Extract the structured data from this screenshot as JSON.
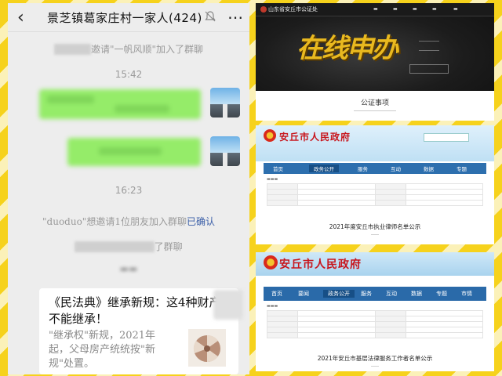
{
  "chat": {
    "title": "景芝镇葛家庄村一家人(424)",
    "join_notice_prefix": "邀请\"一帆风顺\"加入了群聊",
    "time_1": "15:42",
    "time_2": "16:23",
    "invite_notice": "\"duoduo\"想邀请1位朋友加入群聊",
    "invite_confirm": "已确认",
    "join_notice_2": "了群聊",
    "card": {
      "title": "《民法典》继承新规：这4种财产不能继承！",
      "description": "\"继承权\"新规，2021年起，父母房产统统按\"新规\"处置。"
    }
  },
  "notary": {
    "site_name": "山东省安丘市公证处",
    "hero_text": "在线申办",
    "section_title": "公证事项"
  },
  "gov1": {
    "site_name": "安丘市人民政府",
    "nav": [
      "首页",
      "政务公开",
      "服务",
      "互动",
      "数据",
      "专题"
    ],
    "document_title": "2021年度安丘市执业律师名单公示"
  },
  "gov2": {
    "site_name": "安丘市人民政府",
    "nav": [
      "首页",
      "要闻",
      "政务公开",
      "服务",
      "互动",
      "数据",
      "专题",
      "市情"
    ],
    "document_title": "2021年安丘市基层法律服务工作者名单公示"
  },
  "colors": {
    "background": "#f6d21c",
    "bubble_green": "#95ec69",
    "gov_red": "#c8161d",
    "gov_nav_blue": "#2d6fae"
  }
}
